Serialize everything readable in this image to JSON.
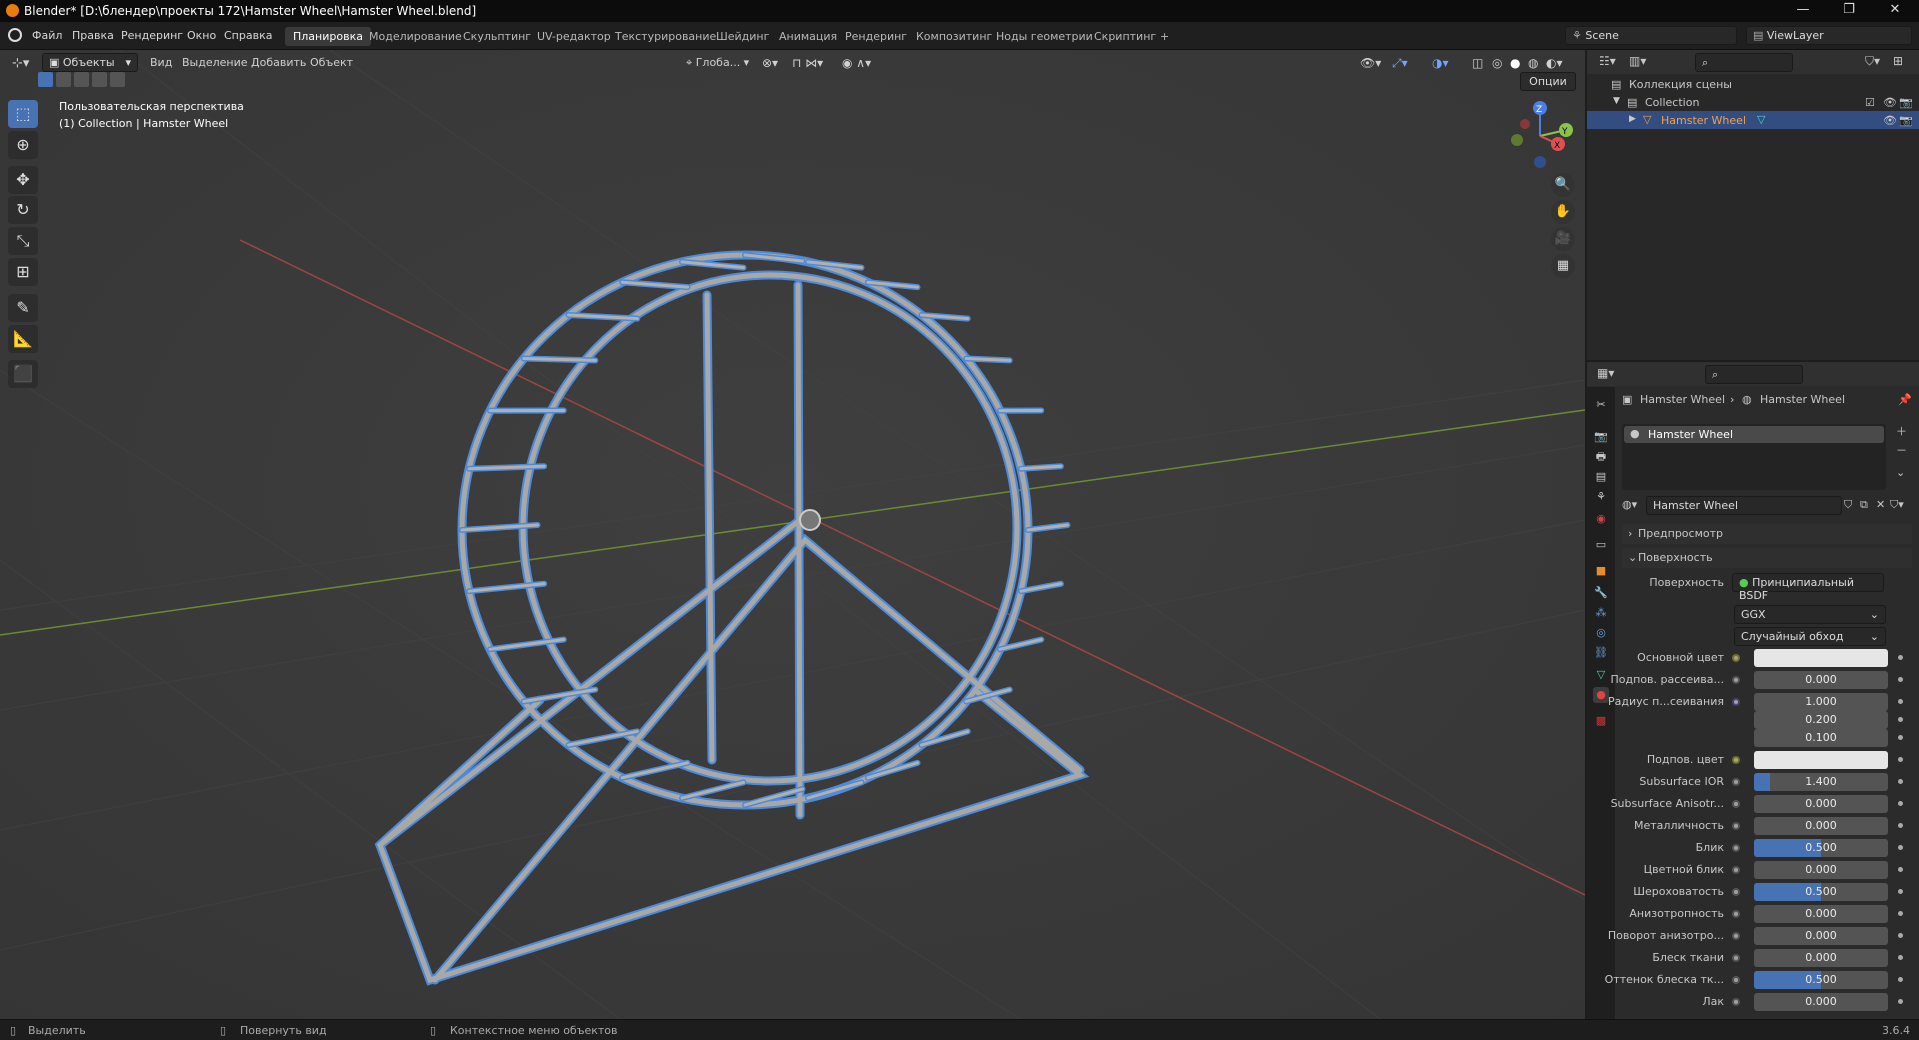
{
  "window": {
    "title": "Blender* [D:\\блендер\\проекты 172\\Hamster Wheel\\Hamster Wheel.blend]"
  },
  "menu": [
    "Файл",
    "Правка",
    "Рендеринг",
    "Окно",
    "Справка"
  ],
  "workspaces": [
    "Планировка",
    "Моделирование",
    "Скульптинг",
    "UV-редактор",
    "Текстурирование",
    "Шейдинг",
    "Анимация",
    "Рендеринг",
    "Композитинг",
    "Ноды геометрии",
    "Скриптинг",
    "+"
  ],
  "scene": {
    "name": "Scene",
    "view_layer": "ViewLayer"
  },
  "viewport": {
    "mode": "Объекты",
    "menu": [
      "Вид",
      "Выделение",
      "Добавить",
      "Объект"
    ],
    "transform": "Глоба...",
    "options": "Опции",
    "info_line1": "Пользовательская перспектива",
    "info_line2": "(1) Collection | Hamster Wheel"
  },
  "outliner": {
    "root": "Коллекция сцены",
    "collection": "Collection",
    "object": "Hamster Wheel"
  },
  "properties": {
    "breadcrumb_object": "Hamster Wheel",
    "breadcrumb_material": "Hamster Wheel",
    "slot": "Hamster Wheel",
    "material_name": "Hamster Wheel",
    "panel_preview": "Предпросмотр",
    "panel_surface": "Поверхность",
    "surface_label": "Поверхность",
    "surface_value": "Принципиальный BSDF",
    "distribution": "GGX",
    "subsurface_method": "Случайный обход",
    "rows": [
      {
        "label": "Основной цвет",
        "value": "",
        "color": "#e6e6e6",
        "dot": "yellow"
      },
      {
        "label": "Подпов. рассеива...",
        "value": "0.000",
        "fill": 0
      },
      {
        "label": "Радиус п...сеивания",
        "value": "1.000",
        "fill": 0,
        "dot": "purple"
      },
      {
        "label": "",
        "value": "0.200",
        "fill": 0,
        "nodot": true
      },
      {
        "label": "",
        "value": "0.100",
        "fill": 0,
        "nodot": true
      },
      {
        "label": "Подпов. цвет",
        "value": "",
        "color": "#e6e6e6",
        "dot": "yellow"
      },
      {
        "label": "Subsurface IOR",
        "value": "1.400",
        "fill": 0.12
      },
      {
        "label": "Subsurface Anisotr...",
        "value": "0.000",
        "fill": 0
      },
      {
        "label": "Металличность",
        "value": "0.000",
        "fill": 0
      },
      {
        "label": "Блик",
        "value": "0.500",
        "fill": 0.5
      },
      {
        "label": "Цветной блик",
        "value": "0.000",
        "fill": 0
      },
      {
        "label": "Шероховатость",
        "value": "0.500",
        "fill": 0.5
      },
      {
        "label": "Анизотропность",
        "value": "0.000",
        "fill": 0
      },
      {
        "label": "Поворот анизотро...",
        "value": "0.000",
        "fill": 0
      },
      {
        "label": "Блеск ткани",
        "value": "0.000",
        "fill": 0
      },
      {
        "label": "Оттенок блеска тк...",
        "value": "0.500",
        "fill": 0.5
      },
      {
        "label": "Лак",
        "value": "0.000",
        "fill": 0
      }
    ]
  },
  "status": {
    "left": "Выделить",
    "middle": "Повернуть вид",
    "right": "Контекстное меню объектов",
    "version": "3.6.4"
  },
  "colors": {
    "accent": "#4772b3",
    "selection": "#4d8bd9",
    "grid_x": "#c8524e",
    "grid_y": "#7fa33a"
  }
}
